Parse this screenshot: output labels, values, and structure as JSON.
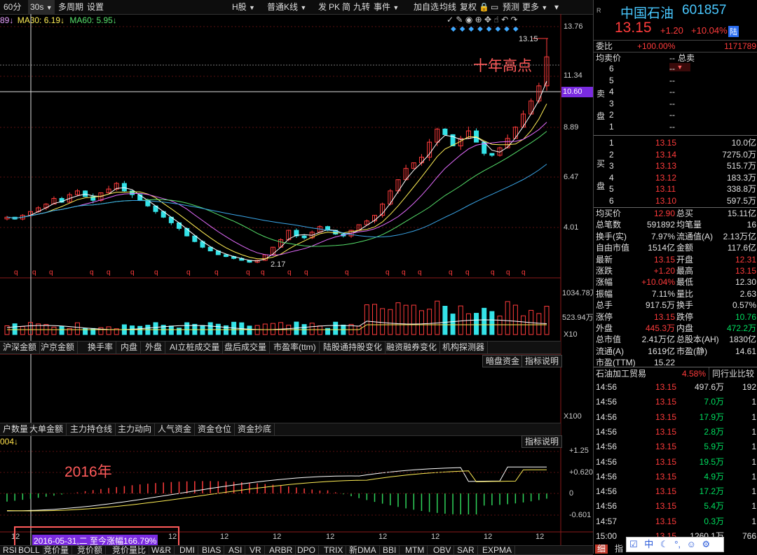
{
  "toolbar": {
    "items": [
      "60分",
      "30s",
      "多周期",
      "设置",
      "H股",
      "普通K线",
      "发",
      "PK",
      "简",
      "九转",
      "事件",
      "加自选",
      "均线",
      "复权",
      "预测",
      "更多"
    ]
  },
  "ma": {
    "ma_a": "89↓",
    "ma30": "MA30: 6.19↓",
    "ma60": "MA60: 5.95↓"
  },
  "price_axis": {
    "labels": [
      "13.76",
      "11.34",
      "8.89",
      "6.47",
      "4.01"
    ],
    "hl_price": "10.60",
    "high_label": "13.15",
    "low_label": "2.17"
  },
  "annot": {
    "ten_year_high": "十年高点",
    "year_2016": "2016年"
  },
  "vol_axis": {
    "labels": [
      "1034.78万",
      "523.94万",
      "X10"
    ]
  },
  "tabs1": [
    "沪深金额",
    "沪京金额",
    "换手率",
    "内盘",
    "外盘",
    "AI立桩成交量",
    "盘后成交量",
    "市盈率(ttm)",
    "陆股通持股变化",
    "融资融券变化",
    "机构探测器"
  ],
  "panel2_btns": [
    "暗盘资金",
    "指标说明"
  ],
  "panel2_axis": "X100",
  "tabs2": [
    "户数量",
    "大单金额",
    "主力持仓线",
    "主力动向",
    "人气资金",
    "资金仓位",
    "资金抄底"
  ],
  "panel3": {
    "title": "004↓",
    "btn": "指标说明",
    "axis": [
      "+1.25",
      "+0.620",
      "0",
      "-0.601"
    ]
  },
  "date_bar": {
    "ticks": [
      "12",
      "12",
      "12",
      "12",
      "12",
      "12",
      "12",
      "12",
      "12",
      "12",
      "12"
    ],
    "highlight": "2016-05-31,二 至今涨幅166.79%"
  },
  "bottom_tabs": [
    "RSI",
    "BOLL",
    "竞价量",
    "竞价额",
    "竞价量比",
    "W&R",
    "DMI",
    "BIAS",
    "ASI",
    "VR",
    "ARBR",
    "DPO",
    "TRIX",
    "新DMA",
    "BBI",
    "MTM",
    "OBV",
    "SAR",
    "EXPMA"
  ],
  "quote": {
    "name": "中国石油",
    "code": "601857",
    "price": "13.15",
    "chg": "+1.20",
    "pct": "+10.04%",
    "tag": "陆",
    "weibi_label": "委比",
    "weibi": "+100.00%",
    "weicha": "1171789",
    "avg_label": "均卖价",
    "avg_val": "--",
    "zongmai": "总卖",
    "sell": [
      {
        "n": "6",
        "p": "--",
        "v": "--"
      },
      {
        "n": "5",
        "p": "--",
        "v": "--"
      },
      {
        "n": "4",
        "p": "--",
        "v": "--"
      },
      {
        "n": "3",
        "p": "--",
        "v": "--"
      },
      {
        "n": "2",
        "p": "--",
        "v": "--"
      },
      {
        "n": "1",
        "p": "--",
        "v": "--"
      }
    ],
    "sell_side": "卖盘",
    "buy": [
      {
        "n": "1",
        "p": "13.15",
        "v": "10.0亿"
      },
      {
        "n": "2",
        "p": "13.14",
        "v": "7275.0万"
      },
      {
        "n": "3",
        "p": "13.13",
        "v": "515.7万"
      },
      {
        "n": "4",
        "p": "13.12",
        "v": "183.3万"
      },
      {
        "n": "5",
        "p": "13.11",
        "v": "338.8万"
      },
      {
        "n": "6",
        "p": "13.10",
        "v": "597.5万"
      }
    ],
    "buy_side": "买盘",
    "stats": [
      [
        "均买价",
        "12.90",
        "总买",
        "15.11亿"
      ],
      [
        "总笔数",
        "591892",
        "均笔量",
        "16"
      ],
      [
        "换手(实)",
        "7.97%",
        "流通值(A)",
        "2.13万亿"
      ],
      [
        "自由市值",
        "1514亿",
        "金额",
        "117.6亿"
      ],
      [
        "最新",
        "13.15",
        "开盘",
        "12.31"
      ],
      [
        "涨跌",
        "+1.20",
        "最高",
        "13.15"
      ],
      [
        "涨幅",
        "+10.04%",
        "最低",
        "12.30"
      ],
      [
        "振幅",
        "7.11%",
        "量比",
        "2.63"
      ],
      [
        "总手",
        "917.5万",
        "换手",
        "0.57%"
      ],
      [
        "涨停",
        "13.15",
        "跌停",
        "10.76"
      ],
      [
        "外盘",
        "445.3万",
        "内盘",
        "472.2万"
      ],
      [
        "总市值",
        "2.41万亿",
        "总股本(AH)",
        "1830亿"
      ],
      [
        "流通(A)",
        "1619亿",
        "市盈(静)",
        "14.61"
      ],
      [
        "市盈(TTM)",
        "15.22",
        "",
        ""
      ]
    ],
    "industry": "石油加工贸易",
    "industry_pct": "4.58%",
    "industry_btn": "同行业比较",
    "ticks": [
      {
        "t": "14:56",
        "p": "13.15",
        "v": "497.6万",
        "x": "192"
      },
      {
        "t": "14:56",
        "p": "13.15",
        "v": "7.0万",
        "x": "1"
      },
      {
        "t": "14:56",
        "p": "13.15",
        "v": "17.9万",
        "x": "1"
      },
      {
        "t": "14:56",
        "p": "13.15",
        "v": "2.8万",
        "x": "1"
      },
      {
        "t": "14:56",
        "p": "13.15",
        "v": "5.9万",
        "x": "1"
      },
      {
        "t": "14:56",
        "p": "13.15",
        "v": "19.5万",
        "x": "1"
      },
      {
        "t": "14:56",
        "p": "13.15",
        "v": "4.9万",
        "x": "1"
      },
      {
        "t": "14:56",
        "p": "13.15",
        "v": "17.2万",
        "x": "1"
      },
      {
        "t": "14:56",
        "p": "13.15",
        "v": "5.4万",
        "x": "1"
      },
      {
        "t": "14:57",
        "p": "13.15",
        "v": "0.3万",
        "x": "1"
      },
      {
        "t": "15:00",
        "p": "13.15",
        "v": "1260.1万",
        "x": "766"
      }
    ],
    "bottom_tabs": [
      "细",
      "指"
    ],
    "ime": [
      "中"
    ]
  },
  "chart_data": {
    "type": "candlestick",
    "title": "",
    "ylim": [
      2.0,
      14.5
    ],
    "series": [
      {
        "name": "MA30",
        "values": []
      },
      {
        "name": "MA60",
        "values": []
      }
    ],
    "close": [
      4.6,
      4.5,
      4.7,
      4.9,
      5.1,
      5.3,
      5.6,
      5.4,
      5.8,
      6.0,
      5.7,
      5.5,
      5.9,
      6.1,
      6.4,
      6.0,
      5.8,
      5.5,
      5.2,
      4.9,
      4.6,
      4.3,
      4.0,
      3.6,
      3.3,
      3.0,
      2.8,
      2.6,
      2.5,
      2.4,
      2.3,
      2.2,
      2.3,
      2.6,
      3.0,
      3.4,
      3.9,
      3.6,
      3.5,
      3.8,
      4.1,
      3.9,
      3.7,
      3.6,
      3.9,
      4.2,
      4.4,
      4.7,
      5.3,
      6.0,
      6.6,
      7.2,
      7.5,
      7.8,
      8.6,
      9.3,
      9.0,
      8.4,
      8.8,
      9.2,
      8.6,
      8.0,
      7.9,
      8.3,
      8.8,
      9.4,
      10.1,
      10.8,
      11.6,
      13.15
    ],
    "highlight_price": 10.6,
    "low_label": "2.17",
    "high_label": "13.15"
  }
}
